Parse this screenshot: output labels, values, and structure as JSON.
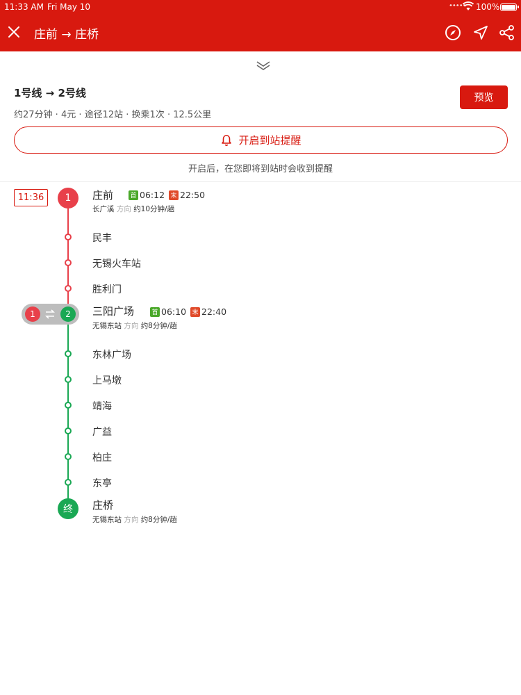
{
  "status_bar": {
    "time": "11:33 AM",
    "date": "Fri May 10",
    "signal_dots": "•••••",
    "battery_text": "100%",
    "battery_level": 1.0
  },
  "nav": {
    "title": "庄前 → 庄桥",
    "close_icon": "close-icon",
    "action_icons": [
      "compass-icon",
      "navigation-arrow-icon",
      "share-icon"
    ]
  },
  "route": {
    "title": "1号线 → 2号线",
    "meta": "约27分钟 · 4元 · 途径12站 · 换乘1次 · 12.5公里",
    "preview_label": "预览",
    "alert_label": "开启到站提醒",
    "alert_hint": "开启后，在您即将到站时会收到提醒"
  },
  "timeline": {
    "departure_time": "11:36",
    "colors": {
      "line1": "#e8404a",
      "line2": "#1aa854",
      "accent": "#d8190f"
    },
    "start": {
      "marker": "1",
      "name": "庄前",
      "first_tag": "首",
      "first_time": "06:12",
      "last_tag": "末",
      "last_time": "22:50",
      "direction_terminal": "长广溪",
      "direction_label": "方向",
      "frequency": "约10分钟/趟"
    },
    "line1_stations": [
      "民丰",
      "无锡火车站",
      "胜利门"
    ],
    "transfer": {
      "from_line": "1",
      "to_line": "2",
      "name": "三阳广场",
      "first_tag": "首",
      "first_time": "06:10",
      "last_tag": "末",
      "last_time": "22:40",
      "direction_terminal": "无锡东站",
      "direction_label": "方向",
      "frequency": "约8分钟/趟"
    },
    "line2_stations": [
      "东林广场",
      "上马墩",
      "靖海",
      "广益",
      "柏庄",
      "东亭"
    ],
    "end": {
      "marker": "终",
      "name": "庄桥",
      "direction_terminal": "无锡东站",
      "direction_label": "方向",
      "frequency": "约8分钟/趟"
    }
  }
}
